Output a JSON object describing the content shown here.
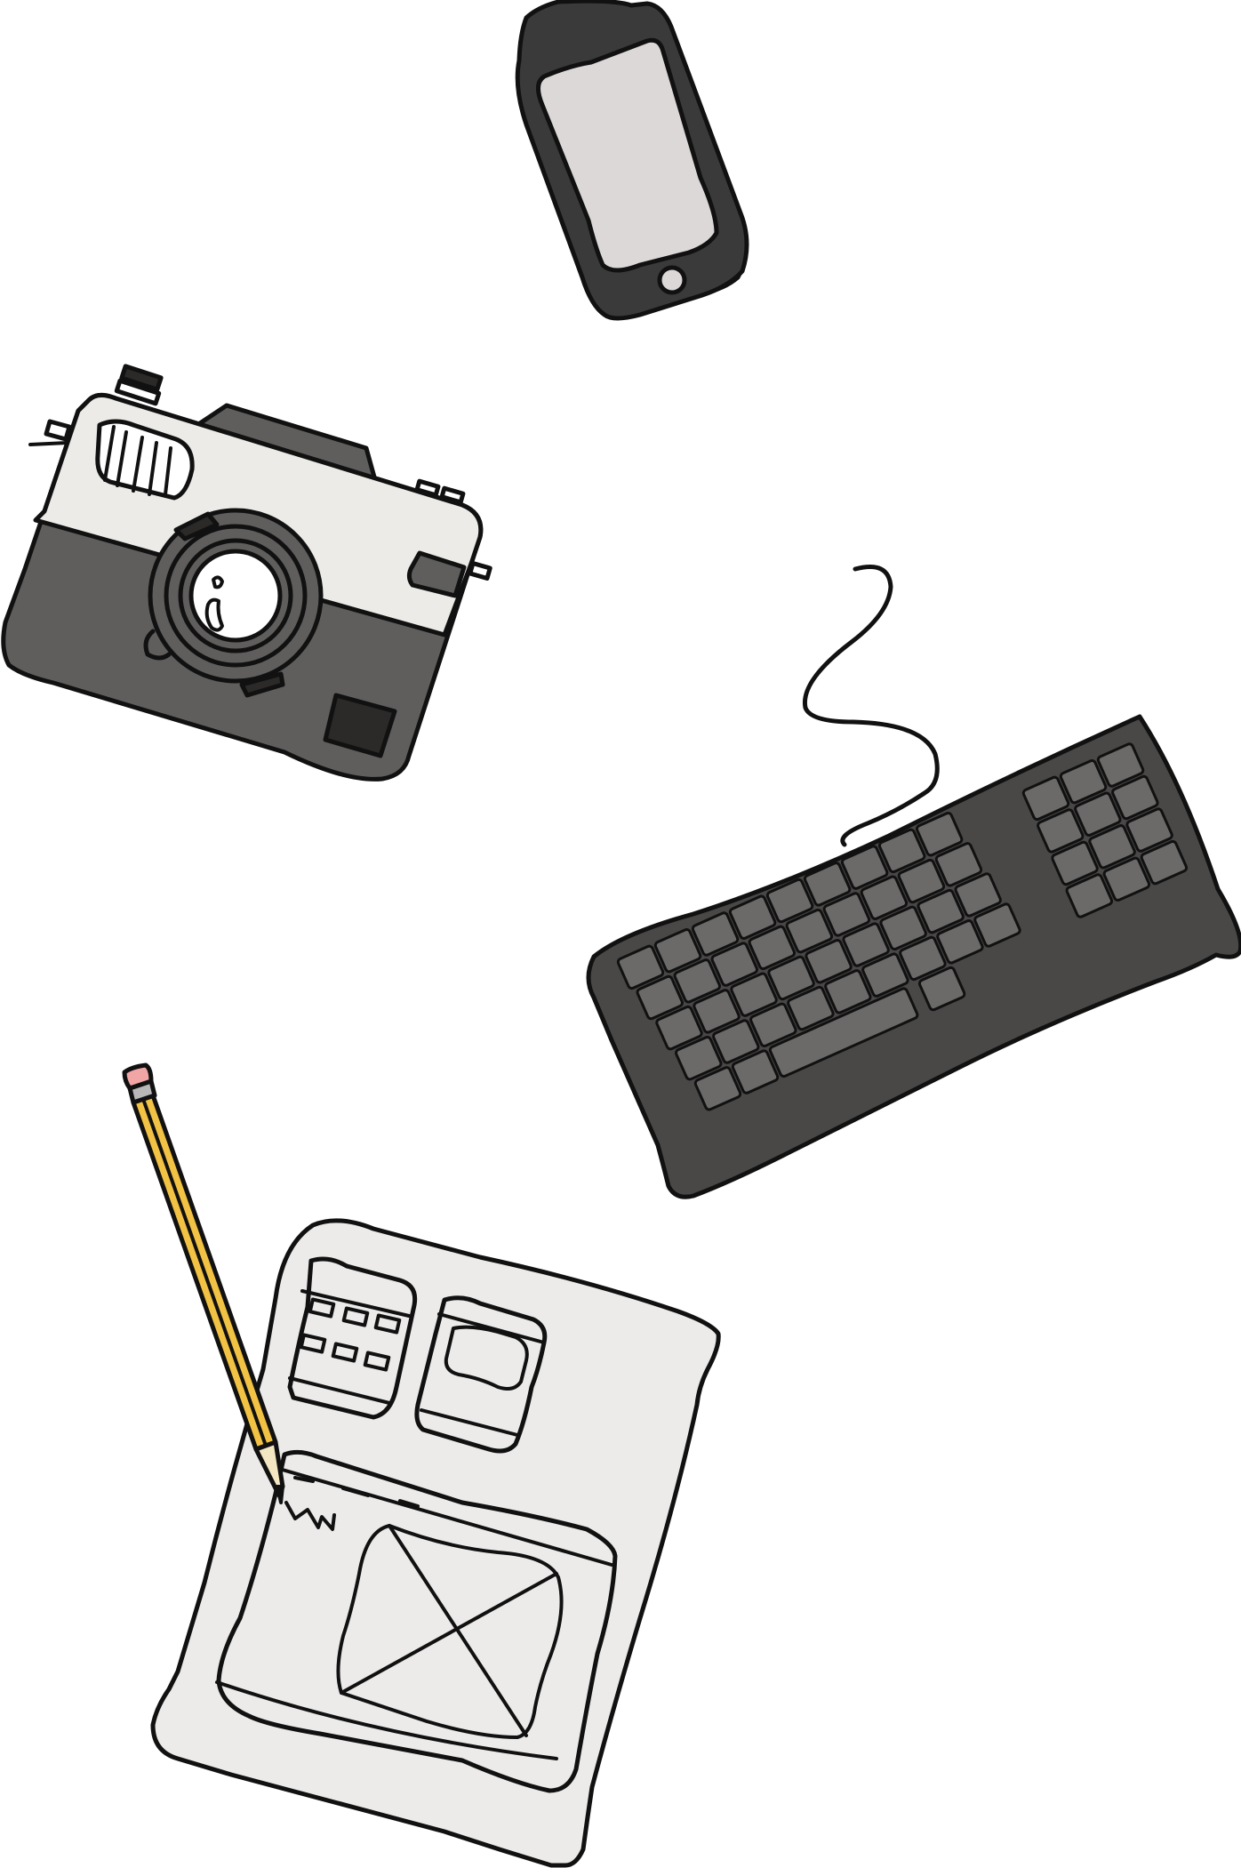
{
  "scene": {
    "background_color": "#ffffff",
    "outline_color": "#111111",
    "objects": [
      {
        "name": "smartphone",
        "icon": "smartphone-icon",
        "body_color": "#3a3a3a",
        "screen_color": "#dcd8d8"
      },
      {
        "name": "camera",
        "icon": "camera-icon",
        "top_color": "#ecebe8",
        "body_color": "#5f5e5d",
        "accent_color": "#2b2a28"
      },
      {
        "name": "keyboard",
        "icon": "keyboard-icon",
        "body_color": "#4a4847",
        "key_color": "#6b6a69"
      },
      {
        "name": "pencil",
        "icon": "pencil-icon",
        "wood_color": "#f2c245",
        "eraser_color": "#f2a5a5",
        "ferrule_color": "#b8b8b8"
      },
      {
        "name": "wireframe-sketch",
        "icon": "wireframe-sketch-icon",
        "paper_color": "#ecebea"
      }
    ]
  }
}
